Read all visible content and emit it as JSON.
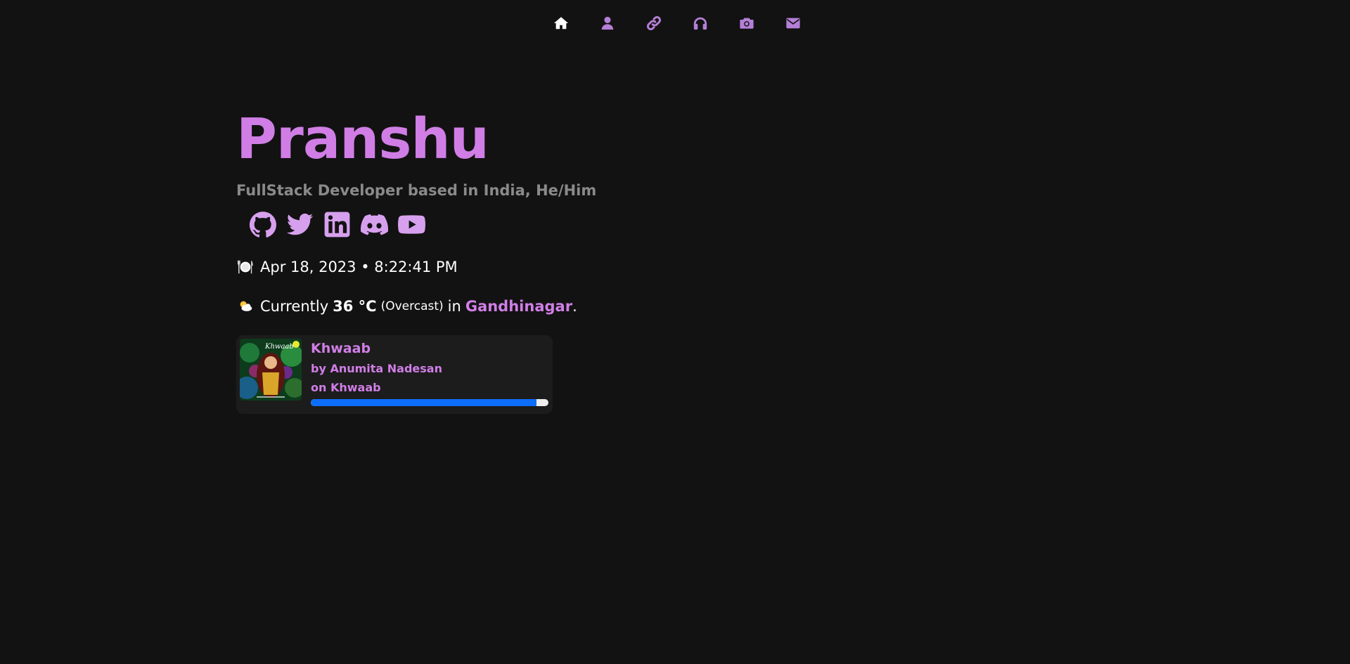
{
  "nav": {
    "items": [
      {
        "icon": "home-icon",
        "color": "#ffffff"
      },
      {
        "icon": "user-icon",
        "color": "#b47fd6"
      },
      {
        "icon": "link-icon",
        "color": "#b47fd6"
      },
      {
        "icon": "headphones-icon",
        "color": "#b47fd6"
      },
      {
        "icon": "camera-icon",
        "color": "#b47fd6"
      },
      {
        "icon": "envelope-icon",
        "color": "#b47fd6"
      }
    ]
  },
  "profile": {
    "name": "Pranshu",
    "tagline": "FullStack Developer based in India, He/Him",
    "accent_color": "#d07ee6"
  },
  "socials": [
    {
      "icon": "github-icon"
    },
    {
      "icon": "twitter-icon"
    },
    {
      "icon": "linkedin-icon"
    },
    {
      "icon": "discord-icon"
    },
    {
      "icon": "youtube-icon"
    }
  ],
  "datetime": {
    "emoji": "fork-knife-plate-icon",
    "text": "Apr 18, 2023 • 8:22:41 PM"
  },
  "weather": {
    "emoji": "sun-behind-cloud-icon",
    "prefix": "Currently",
    "temperature": "36 °C",
    "condition": "(Overcast)",
    "in_word": "in",
    "city": "Gandhinagar",
    "suffix": "."
  },
  "now_playing": {
    "track": "Khwaab",
    "artist": "by Anumita Nadesan",
    "album": "on Khwaab",
    "progress_percent": 95,
    "progress_color": "#0d6efd"
  }
}
